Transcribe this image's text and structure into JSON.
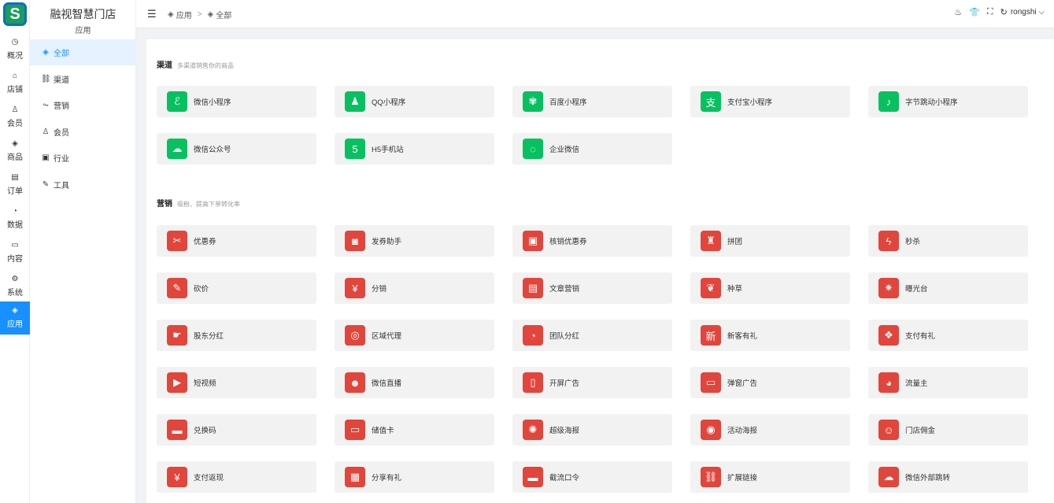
{
  "rail": {
    "items": [
      {
        "label": "概况",
        "icon": "dashboard-icon",
        "glyph": "◷"
      },
      {
        "label": "店铺",
        "icon": "store-icon",
        "glyph": "⌂"
      },
      {
        "label": "会员",
        "icon": "user-icon",
        "glyph": "♙"
      },
      {
        "label": "商品",
        "icon": "box-icon",
        "glyph": "◈"
      },
      {
        "label": "订单",
        "icon": "order-icon",
        "glyph": "▤"
      },
      {
        "label": "数据",
        "icon": "pie-icon",
        "glyph": "◔"
      },
      {
        "label": "内容",
        "icon": "folder-icon",
        "glyph": "▭"
      },
      {
        "label": "系统",
        "icon": "gear-icon",
        "glyph": "⚙"
      },
      {
        "label": "应用",
        "icon": "app-cube-icon",
        "glyph": "◈"
      }
    ],
    "active_index": 8
  },
  "sub": {
    "title": "融视智慧门店",
    "subtitle": "应用",
    "items": [
      {
        "label": "全部",
        "icon": "cube-icon",
        "glyph": "◈"
      },
      {
        "label": "渠道",
        "icon": "channel-icon",
        "glyph": "⛓"
      },
      {
        "label": "营销",
        "icon": "chart-icon",
        "glyph": "⏦"
      },
      {
        "label": "会员",
        "icon": "user-icon",
        "glyph": "♙"
      },
      {
        "label": "行业",
        "icon": "industry-icon",
        "glyph": "▣"
      },
      {
        "label": "工具",
        "icon": "wrench-icon",
        "glyph": "✎"
      }
    ],
    "active_index": 0
  },
  "header": {
    "breadcrumb": [
      {
        "label": "应用",
        "glyph": "◈"
      },
      {
        "label": "全部",
        "glyph": "◈"
      }
    ],
    "breadcrumb_sep": ">",
    "username": "rongshi",
    "icons": [
      {
        "name": "skin-icon",
        "glyph": "♨"
      },
      {
        "name": "shirt-icon",
        "glyph": "👕"
      },
      {
        "name": "fullscreen-icon",
        "glyph": "⛶"
      },
      {
        "name": "refresh-icon",
        "glyph": "↻"
      }
    ]
  },
  "sections": [
    {
      "title": "渠道",
      "desc": "多渠道销售你的商品",
      "color": "#07c160",
      "items": [
        {
          "label": "微信小程序",
          "glyph": "ℰ"
        },
        {
          "label": "QQ小程序",
          "glyph": "♟"
        },
        {
          "label": "百度小程序",
          "glyph": "✾"
        },
        {
          "label": "支付宝小程序",
          "glyph": "支"
        },
        {
          "label": "字节跳动小程序",
          "glyph": "♪"
        },
        {
          "label": "微信公众号",
          "glyph": "☁"
        },
        {
          "label": "H5手机站",
          "glyph": "5"
        },
        {
          "label": "企业微信",
          "glyph": "◌"
        }
      ]
    },
    {
      "title": "营销",
      "desc": "吸粉、提高下单转化率",
      "color": "#e2453c",
      "items": [
        {
          "label": "优惠券",
          "glyph": "✂"
        },
        {
          "label": "发券助手",
          "glyph": "◙"
        },
        {
          "label": "核销优惠券",
          "glyph": "▣"
        },
        {
          "label": "拼团",
          "glyph": "♜"
        },
        {
          "label": "秒杀",
          "glyph": "ϟ"
        },
        {
          "label": "砍价",
          "glyph": "✎"
        },
        {
          "label": "分销",
          "glyph": "¥"
        },
        {
          "label": "文章营销",
          "glyph": "▤"
        },
        {
          "label": "种草",
          "glyph": "❦"
        },
        {
          "label": "曝光台",
          "glyph": "✷"
        },
        {
          "label": "股东分红",
          "glyph": "☛"
        },
        {
          "label": "区域代理",
          "glyph": "◎"
        },
        {
          "label": "团队分红",
          "glyph": "◔"
        },
        {
          "label": "新客有礼",
          "glyph": "新"
        },
        {
          "label": "支付有礼",
          "glyph": "❖"
        },
        {
          "label": "短视频",
          "glyph": "▶"
        },
        {
          "label": "微信直播",
          "glyph": "☻"
        },
        {
          "label": "开屏广告",
          "glyph": "▯"
        },
        {
          "label": "弹窗广告",
          "glyph": "▭"
        },
        {
          "label": "流量主",
          "glyph": "◕"
        },
        {
          "label": "兑换码",
          "glyph": "▬"
        },
        {
          "label": "储值卡",
          "glyph": "▭"
        },
        {
          "label": "超级海报",
          "glyph": "✺"
        },
        {
          "label": "活动海报",
          "glyph": "◉"
        },
        {
          "label": "门店佣金",
          "glyph": "☺"
        },
        {
          "label": "支付返现",
          "glyph": "¥"
        },
        {
          "label": "分享有礼",
          "glyph": "▦"
        },
        {
          "label": "截流口令",
          "glyph": "▬"
        },
        {
          "label": "扩展链接",
          "glyph": "⛓"
        },
        {
          "label": "微信外部跳转",
          "glyph": "☁"
        }
      ]
    }
  ]
}
